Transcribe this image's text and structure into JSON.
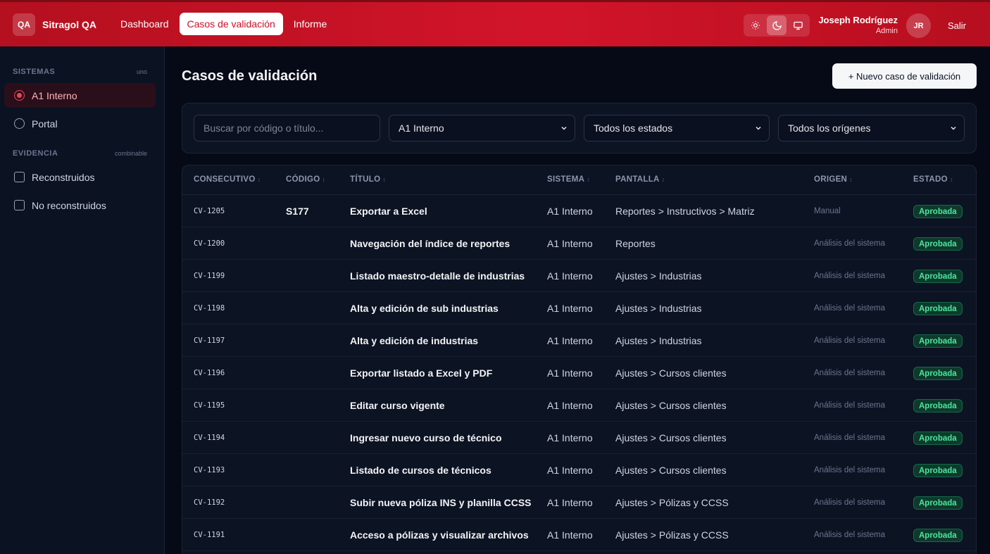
{
  "header": {
    "logo_text": "QA",
    "app_name": "Sitragol QA",
    "nav": [
      {
        "label": "Dashboard",
        "active": false
      },
      {
        "label": "Casos de validación",
        "active": true
      },
      {
        "label": "Informe",
        "active": false
      }
    ],
    "theme_icons": [
      "sun-icon",
      "moon-icon",
      "monitor-icon"
    ],
    "user_name": "Joseph Rodríguez",
    "user_role": "Admin",
    "avatar_initials": "JR",
    "logout_label": "Salir",
    "accent_color": "#d2142a"
  },
  "sidebar": {
    "systems_title": "SISTEMAS",
    "systems_hint": "uno",
    "systems": [
      {
        "label": "A1 Interno",
        "selected": true
      },
      {
        "label": "Portal",
        "selected": false
      }
    ],
    "evidence_title": "EVIDENCIA",
    "evidence_hint": "combinable",
    "evidence": [
      {
        "label": "Reconstruidos",
        "checked": false
      },
      {
        "label": "No reconstruidos",
        "checked": false
      }
    ]
  },
  "main": {
    "title": "Casos de validación",
    "new_button": "+ Nuevo caso de validación",
    "filters": {
      "search_placeholder": "Buscar por código o título...",
      "system": "A1 Interno",
      "status": "Todos los estados",
      "origin": "Todos los orígenes"
    },
    "columns": [
      "CONSECUTIVO",
      "CÓDIGO",
      "TÍTULO",
      "SISTEMA",
      "PANTALLA",
      "ORIGEN",
      "ESTADO"
    ],
    "rows": [
      {
        "consecutivo": "CV-1205",
        "codigo": "S177",
        "titulo": "Exportar a Excel",
        "sistema": "A1 Interno",
        "pantalla": "Reportes > Instructivos > Matriz",
        "origen": "Manual",
        "estado": "Aprobada"
      },
      {
        "consecutivo": "CV-1200",
        "codigo": "",
        "titulo": "Navegación del índice de reportes",
        "sistema": "A1 Interno",
        "pantalla": "Reportes",
        "origen": "Análisis del sistema",
        "estado": "Aprobada"
      },
      {
        "consecutivo": "CV-1199",
        "codigo": "",
        "titulo": "Listado maestro-detalle de industrias",
        "sistema": "A1 Interno",
        "pantalla": "Ajustes > Industrias",
        "origen": "Análisis del sistema",
        "estado": "Aprobada"
      },
      {
        "consecutivo": "CV-1198",
        "codigo": "",
        "titulo": "Alta y edición de sub industrias",
        "sistema": "A1 Interno",
        "pantalla": "Ajustes > Industrias",
        "origen": "Análisis del sistema",
        "estado": "Aprobada"
      },
      {
        "consecutivo": "CV-1197",
        "codigo": "",
        "titulo": "Alta y edición de industrias",
        "sistema": "A1 Interno",
        "pantalla": "Ajustes > Industrias",
        "origen": "Análisis del sistema",
        "estado": "Aprobada"
      },
      {
        "consecutivo": "CV-1196",
        "codigo": "",
        "titulo": "Exportar listado a Excel y PDF",
        "sistema": "A1 Interno",
        "pantalla": "Ajustes > Cursos clientes",
        "origen": "Análisis del sistema",
        "estado": "Aprobada"
      },
      {
        "consecutivo": "CV-1195",
        "codigo": "",
        "titulo": "Editar curso vigente",
        "sistema": "A1 Interno",
        "pantalla": "Ajustes > Cursos clientes",
        "origen": "Análisis del sistema",
        "estado": "Aprobada"
      },
      {
        "consecutivo": "CV-1194",
        "codigo": "",
        "titulo": "Ingresar nuevo curso de técnico",
        "sistema": "A1 Interno",
        "pantalla": "Ajustes > Cursos clientes",
        "origen": "Análisis del sistema",
        "estado": "Aprobada"
      },
      {
        "consecutivo": "CV-1193",
        "codigo": "",
        "titulo": "Listado de cursos de técnicos",
        "sistema": "A1 Interno",
        "pantalla": "Ajustes > Cursos clientes",
        "origen": "Análisis del sistema",
        "estado": "Aprobada"
      },
      {
        "consecutivo": "CV-1192",
        "codigo": "",
        "titulo": "Subir nueva póliza INS y planilla CCSS",
        "sistema": "A1 Interno",
        "pantalla": "Ajustes > Pólizas y CCSS",
        "origen": "Análisis del sistema",
        "estado": "Aprobada"
      },
      {
        "consecutivo": "CV-1191",
        "codigo": "",
        "titulo": "Acceso a pólizas y visualizar archivos",
        "sistema": "A1 Interno",
        "pantalla": "Ajustes > Pólizas y CCSS",
        "origen": "Análisis del sistema",
        "estado": "Aprobada"
      }
    ]
  }
}
